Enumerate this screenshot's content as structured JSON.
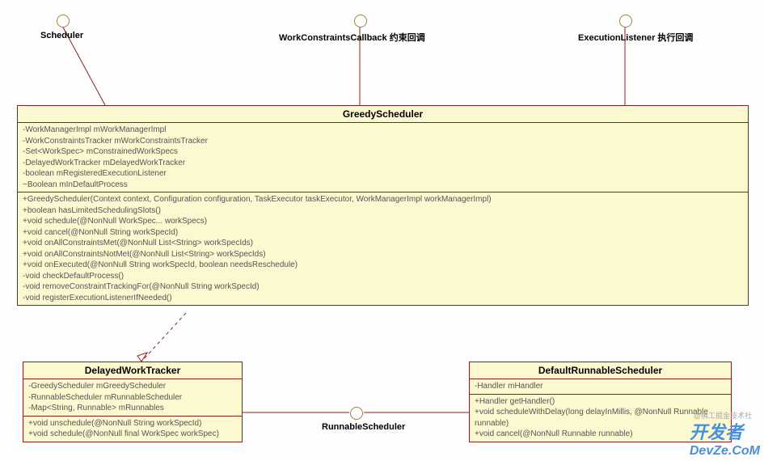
{
  "interfaces": {
    "scheduler": {
      "label": "Scheduler"
    },
    "workConstraintsCallback": {
      "label": "WorkConstraintsCallback 约束回调"
    },
    "executionListener": {
      "label": "ExecutionListener 执行回调"
    },
    "runnableScheduler": {
      "label": "RunnableScheduler"
    }
  },
  "greedyScheduler": {
    "title": "GreedyScheduler",
    "fields": [
      "-WorkManagerImpl mWorkManagerImpl",
      "-WorkConstraintsTracker mWorkConstraintsTracker",
      "-Set<WorkSpec> mConstrainedWorkSpecs",
      "-DelayedWorkTracker mDelayedWorkTracker",
      "-boolean mRegisteredExecutionListener",
      "~Boolean mInDefaultProcess"
    ],
    "methods": [
      "+GreedyScheduler(Context context, Configuration configuration, TaskExecutor taskExecutor, WorkManagerImpl workManagerImpl)",
      "+boolean hasLimitedSchedulingSlots()",
      "+void schedule(@NonNull WorkSpec... workSpecs)",
      "+void cancel(@NonNull String workSpecId)",
      "+void onAllConstraintsMet(@NonNull List<String> workSpecIds)",
      "+void onAllConstraintsNotMet(@NonNull List<String> workSpecIds)",
      "+void onExecuted(@NonNull String workSpecId, boolean needsReschedule)",
      "-void checkDefaultProcess()",
      "-void removeConstraintTrackingFor(@NonNull String workSpecId)",
      "-void registerExecutionListenerIfNeeded()"
    ]
  },
  "delayedWorkTracker": {
    "title": "DelayedWorkTracker",
    "fields": [
      "-GreedyScheduler mGreedyScheduler",
      "-RunnableScheduler mRunnableScheduler",
      "-Map<String, Runnable> mRunnables"
    ],
    "methods": [
      "+void unschedule(@NonNull String workSpecId)",
      "+void schedule(@NonNull final WorkSpec workSpec)"
    ]
  },
  "defaultRunnableScheduler": {
    "title": "DefaultRunnableScheduler",
    "fields": [
      "-Handler mHandler"
    ],
    "methods": [
      "+Handler getHandler()",
      "+void scheduleWithDelay(long delayInMillis, @NonNull Runnable runnable)",
      "+void cancel(@NonNull Runnable runnable)"
    ]
  },
  "watermark": {
    "main": "开发者",
    "sub": "DevZe.CoM",
    "footer": "@佛工掘金技术社"
  }
}
